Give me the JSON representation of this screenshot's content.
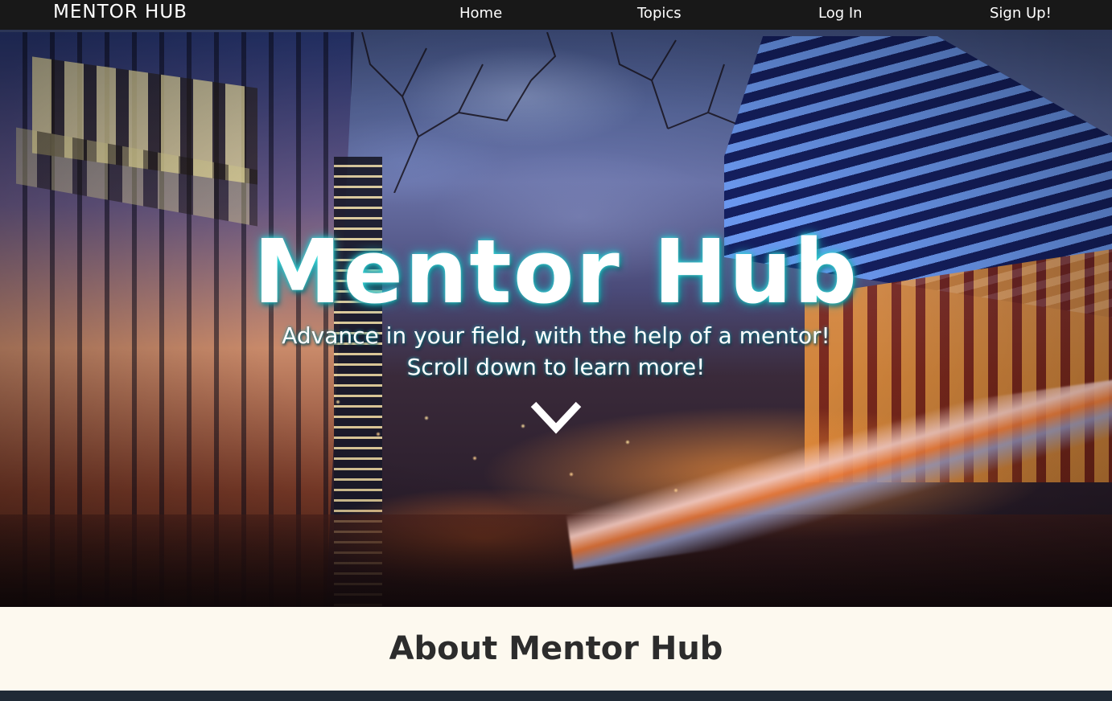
{
  "navbar": {
    "brand": "MENTOR HUB",
    "links": [
      {
        "label": "Home"
      },
      {
        "label": "Topics"
      },
      {
        "label": "Log In"
      },
      {
        "label": "Sign Up!"
      }
    ]
  },
  "hero": {
    "title": "Mentor Hub",
    "subtitle_line1": "Advance in your field, with the help of a mentor!",
    "subtitle_line2": "Scroll down to learn more!",
    "scroll_icon": "chevron-down-icon",
    "glow_color": "#3fe3e0"
  },
  "about": {
    "title": "About Mentor Hub",
    "background_color": "#fdf9ef"
  },
  "colors": {
    "navbar_bg": "#181818",
    "footer_strip": "#1f2a36",
    "text_dark": "#2c2c2c"
  }
}
